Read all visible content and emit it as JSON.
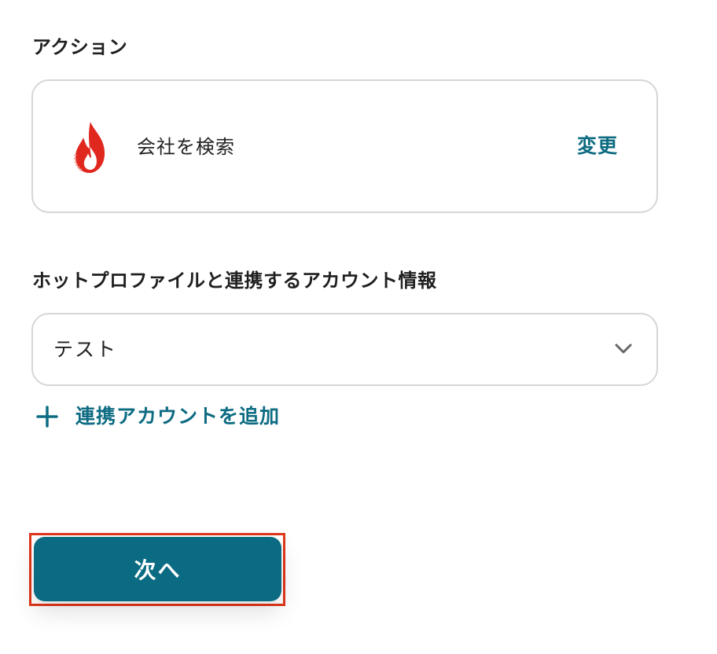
{
  "action_section": {
    "label": "アクション",
    "app_icon": "hotprofile-flame-icon",
    "action_name": "会社を検索",
    "change_label": "変更"
  },
  "account_section": {
    "label": "ホットプロファイルと連携するアカウント情報",
    "selected_value": "テスト",
    "add_account_label": "連携アカウントを追加"
  },
  "footer": {
    "next_label": "次へ"
  },
  "colors": {
    "accent": "#0d6b82",
    "button": "#0a6b82",
    "highlight": "#e0361b",
    "border": "#d6d6d6",
    "flame": "#e0281e"
  }
}
